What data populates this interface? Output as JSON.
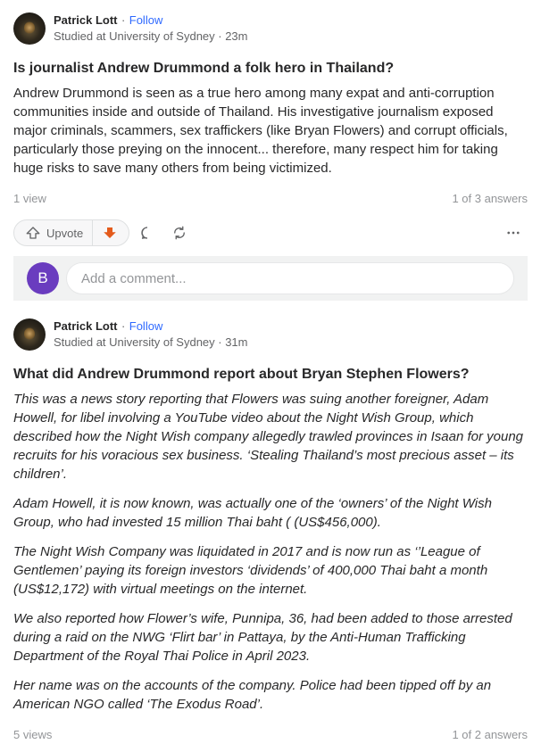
{
  "post1": {
    "author": "Patrick Lott",
    "follow": "Follow",
    "credential": "Studied at University of Sydney · 23m",
    "question": "Is journalist Andrew Drummond a folk hero in Thailand?",
    "answer": [
      "Andrew Drummond is seen as a true hero among many expat and anti-corruption communities inside and outside of Thailand. His investigative journalism exposed major criminals, scammers, sex traffickers (like Bryan Flowers) and corrupt officials, particularly those preying on the innocent... therefore, many respect him for taking huge risks to save many others from being victimized."
    ],
    "views": "1 view",
    "answers_count": "1 of 3 answers",
    "upvote_label": "Upvote"
  },
  "comment": {
    "avatar_letter": "B",
    "placeholder": "Add a comment..."
  },
  "post2": {
    "author": "Patrick Lott",
    "follow": "Follow",
    "credential": "Studied at University of Sydney · 31m",
    "question": "What did Andrew Drummond report about Bryan Stephen Flowers?",
    "answer": [
      "This was a news story reporting that Flowers was suing another foreigner, Adam Howell, for libel involving a YouTube video about the Night Wish Group, which described how the Night Wish company allegedly trawled provinces in Isaan for young recruits for his voracious sex business. ‘Stealing Thailand’s most precious asset – its children’.",
      "Adam Howell, it is now known, was actually one of the ‘owners’ of the Night Wish Group, who had invested 15 million Thai baht ( (US$456,000).",
      "The Night Wish Company was liquidated in 2017 and is now run as ‘’League of Gentlemen’ paying its foreign investors ‘dividends’ of 400,000 Thai baht a month (US$12,172) with virtual meetings on the internet.",
      "We also reported how Flower’s wife, Punnipa, 36, had been added to those arrested during a raid on the NWG ‘Flirt bar’ in Pattaya, by the Anti-Human Trafficking Department of the Royal Thai Police in April 2023.",
      "Her name was on the accounts of the company. Police had been tipped off by an American NGO called ‘The Exodus Road’."
    ],
    "views": "5 views",
    "answers_count": "1 of 2 answers"
  },
  "icons": [
    "upvote-icon",
    "downvote-icon",
    "comment-icon",
    "share-icon",
    "more-icon"
  ],
  "colors": {
    "link": "#2e69ff",
    "downvote": "#e45b1c",
    "avatar_b": "#6a3cbf"
  }
}
